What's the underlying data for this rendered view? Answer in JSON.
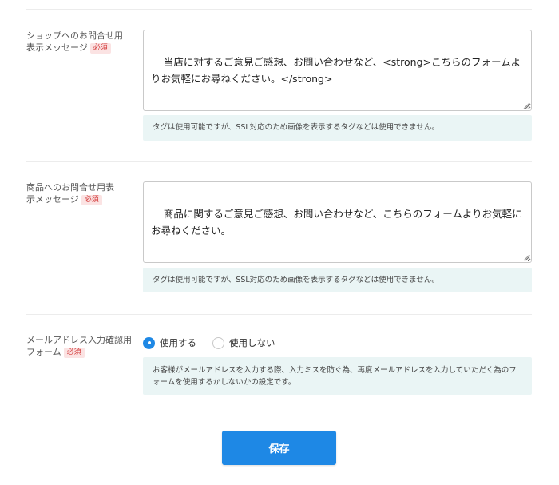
{
  "shop_inquiry": {
    "label": "ショップへのお問合せ用表示メッセージ",
    "required_badge": "必須",
    "value": "当店に対するご意見ご感想、お問い合わせなど、<strong>こちらのフォームよりお気軽にお尋ねください。</strong>",
    "note": "タグは使用可能ですが、SSL対応のため画像を表示するタグなどは使用できません。"
  },
  "product_inquiry": {
    "label": "商品へのお問合せ用表示メッセージ",
    "required_badge": "必須",
    "value": "商品に関するご意見ご感想、お問い合わせなど、こちらのフォームよりお気軽にお尋ねください。",
    "note": "タグは使用可能ですが、SSL対応のため画像を表示するタグなどは使用できません。"
  },
  "email_confirm": {
    "label": "メールアドレス入力確認用フォーム",
    "required_badge": "必須",
    "options": [
      {
        "label": "使用する",
        "checked": true
      },
      {
        "label": "使用しない",
        "checked": false
      }
    ],
    "note": "お客様がメールアドレスを入力する際、入力ミスを防ぐ為、再度メールアドレスを入力していただく為のフォームを使用するかしないかの設定です。"
  },
  "save_button": {
    "label": "保存"
  },
  "colors": {
    "accent": "#1e88e5",
    "note_bg": "#eaf5f5",
    "badge_bg": "#fbe3e3",
    "badge_text": "#d33a3a"
  }
}
